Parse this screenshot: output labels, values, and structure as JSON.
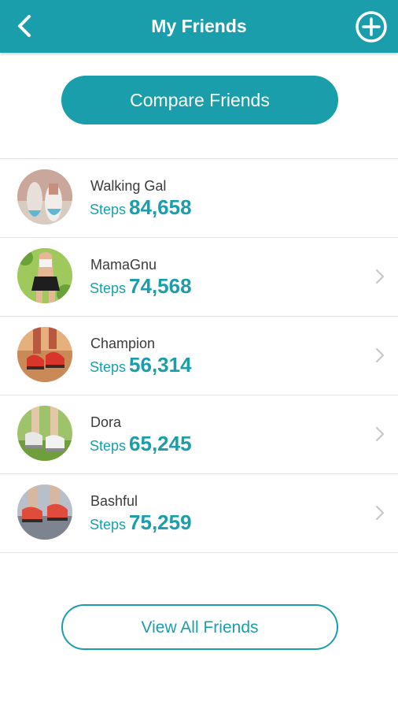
{
  "header": {
    "title": "My Friends",
    "back_icon": "chevron-left-icon",
    "add_icon": "plus-circle-icon"
  },
  "compare_button": {
    "label": "Compare Friends"
  },
  "steps_label": "Steps",
  "friends": [
    {
      "name": "Walking Gal",
      "steps": "84,658",
      "avatar": "walking-shoes-photo",
      "has_chevron": false
    },
    {
      "name": "MamaGnu",
      "steps": "74,568",
      "avatar": "jogging-woman-photo",
      "has_chevron": true
    },
    {
      "name": "Champion",
      "steps": "56,314",
      "avatar": "running-shoes-photo",
      "has_chevron": true
    },
    {
      "name": "Dora",
      "steps": "65,245",
      "avatar": "sneakers-on-grass-photo",
      "has_chevron": true
    },
    {
      "name": "Bashful",
      "steps": "75,259",
      "avatar": "runner-feet-photo",
      "has_chevron": true
    }
  ],
  "view_all_button": {
    "label": "View All Friends"
  },
  "colors": {
    "accent": "#1b9eab",
    "divider": "#e3e3e3",
    "name_text": "#3b3b3b",
    "chevron": "#c8c8c8"
  }
}
